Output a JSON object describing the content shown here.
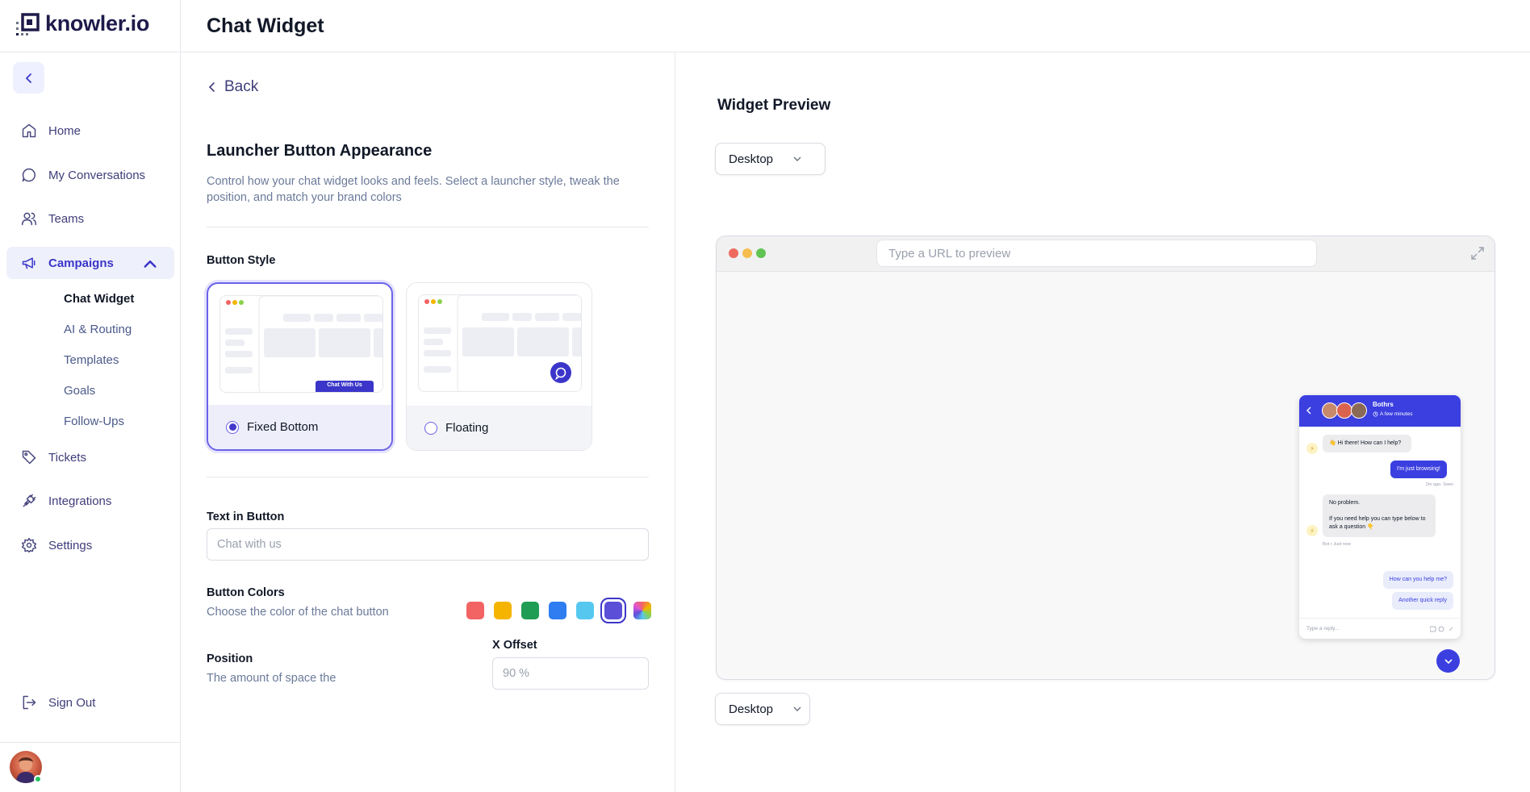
{
  "brand": {
    "name": "knowler.io",
    "accent": "#3b36c9"
  },
  "header": {
    "title": "Chat Widget"
  },
  "sidebar": {
    "items": [
      {
        "label": "Home",
        "icon": "home-icon"
      },
      {
        "label": "My Conversations",
        "icon": "chat-bubble-icon"
      },
      {
        "label": "Teams",
        "icon": "users-icon"
      },
      {
        "label": "Campaigns",
        "icon": "megaphone-icon"
      },
      {
        "label": "Tickets",
        "icon": "tag-icon"
      },
      {
        "label": "Integrations",
        "icon": "plug-icon"
      },
      {
        "label": "Settings",
        "icon": "gear-icon"
      }
    ],
    "sub_items": [
      {
        "label": "Chat Widget"
      },
      {
        "label": "AI & Routing"
      },
      {
        "label": "Templates"
      },
      {
        "label": "Goals"
      },
      {
        "label": "Follow-Ups"
      }
    ],
    "sign_out": "Sign Out"
  },
  "editor": {
    "back_label": "Back",
    "section_title": "Launcher Button Appearance",
    "section_desc": "Control how your chat widget looks and feels. Select a launcher style, tweak the position, and match your brand colors",
    "button_style": {
      "label": "Button Style",
      "options": [
        {
          "label": "Fixed Bottom",
          "selected": true,
          "preview_button": "Chat With Us"
        },
        {
          "label": "Floating",
          "selected": false
        }
      ]
    },
    "text_in_button": {
      "label": "Text in Button",
      "placeholder": "Chat with us"
    },
    "button_colors": {
      "label": "Button Colors",
      "desc": "Choose the color of the chat button",
      "swatches": [
        "#f26363",
        "#f5b400",
        "#1f9d55",
        "#2f7df0",
        "#56c8f0",
        "#5b4fd8",
        "gradient"
      ],
      "selected_index": 5
    },
    "position": {
      "label": "Position",
      "desc": "The amount of space the"
    },
    "x_offset": {
      "label": "X Offset",
      "placeholder": "90 %"
    }
  },
  "preview": {
    "title": "Widget Preview",
    "device_top": "Desktop",
    "device_bottom": "Desktop",
    "url_placeholder": "Type a URL to preview",
    "widget": {
      "name": "Bothrs",
      "status": "A few minutes",
      "messages": [
        {
          "from": "bot",
          "text": "👋 Hi there! How can I help?"
        },
        {
          "from": "me",
          "text": "I'm just browsing!"
        },
        {
          "meta": "2m ago. Seen"
        },
        {
          "from": "bot",
          "text1": "No problem.",
          "text2": "If you need help you can type below to ask a question 👇"
        },
        {
          "meta": "Bot • Just now"
        }
      ],
      "quick_replies": [
        "How can you help me?",
        "Another quick reply"
      ],
      "input_placeholder": "Type a reply..."
    }
  }
}
